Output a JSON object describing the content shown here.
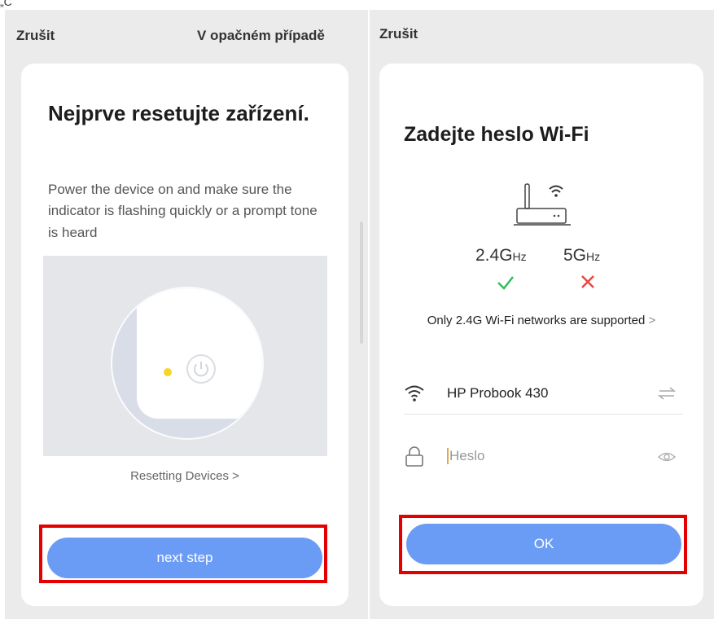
{
  "stray_mark": "„C",
  "left": {
    "cancel_label": "Zrušit",
    "right_label": "V opačném případě",
    "title": "Nejprve resetujte zařízení.",
    "description": "Power the device on and make sure the indicator is flashing quickly or a prompt tone is heard",
    "reset_link": "Resetting Devices >",
    "button_label": "next step"
  },
  "right": {
    "cancel_label": "Zrušit",
    "title": "Zadejte heslo Wi-Fi",
    "freq_24": "2.4G",
    "freq_24_unit": "Hz",
    "freq_5": "5G",
    "freq_5_unit": "Hz",
    "support_note": "Only 2.4G Wi-Fi networks are supported",
    "support_chevron": ">",
    "wifi_name": "HP Probook 430",
    "password_placeholder": "Heslo",
    "button_label": "OK"
  },
  "colors": {
    "accent": "#6b9cf5",
    "highlight": "#e50000",
    "check": "#2fbf5a",
    "cross": "#e8473f",
    "led": "#f7d42a"
  },
  "icons": [
    "power-icon",
    "router-icon",
    "wifi-icon",
    "check-icon",
    "cross-icon",
    "lock-icon",
    "switch-network-icon",
    "eye-icon"
  ]
}
